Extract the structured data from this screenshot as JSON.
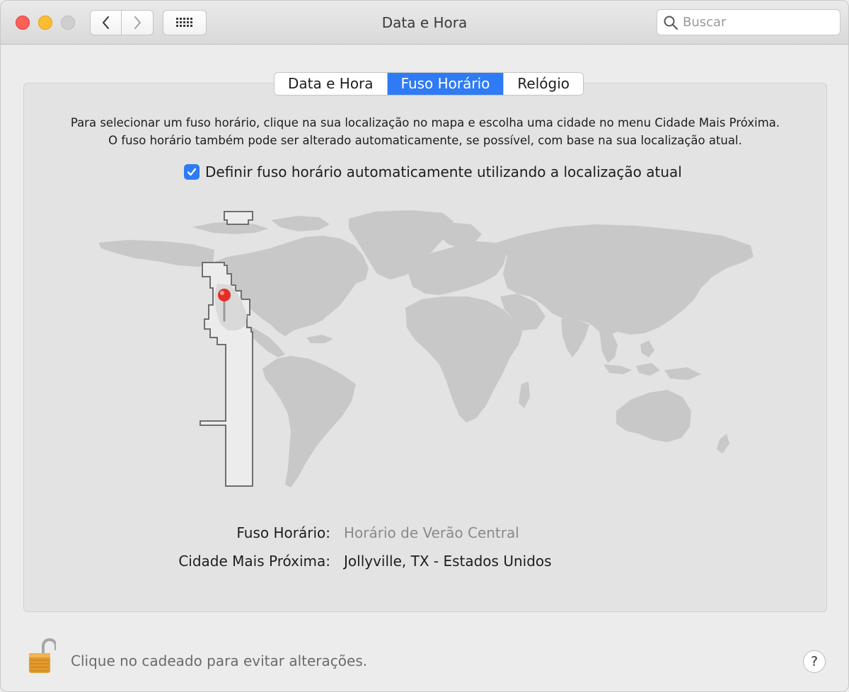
{
  "window": {
    "title": "Data e Hora",
    "search_placeholder": "Buscar"
  },
  "tabs": [
    {
      "label": "Data e Hora",
      "active": false
    },
    {
      "label": "Fuso Horário",
      "active": true
    },
    {
      "label": "Relógio",
      "active": false
    }
  ],
  "description": {
    "line1": "Para selecionar um fuso horário, clique na sua localização no mapa e escolha uma cidade no menu Cidade Mais Próxima.",
    "line2": "O fuso horário também pode ser alterado automaticamente, se possível, com base na sua localização atual."
  },
  "auto_timezone": {
    "label": "Definir fuso horário automaticamente utilizando a localização atual",
    "checked": true
  },
  "info": {
    "timezone_label": "Fuso Horário:",
    "timezone_value": "Horário de Verão Central",
    "city_label": "Cidade Mais Próxima:",
    "city_value": "Jollyville, TX - Estados Unidos"
  },
  "footer": {
    "lock_text": "Clique no cadeado para evitar alterações.",
    "help_label": "?"
  },
  "colors": {
    "accent": "#2f7bf5",
    "land": "#c8c8c8",
    "selected_zone": "#ececec",
    "pin": "#e52d27"
  },
  "icons": [
    "chevron-left-icon",
    "chevron-right-icon",
    "grid-icon",
    "search-icon",
    "checkmark-icon",
    "map-pin-icon",
    "lock-open-icon"
  ]
}
